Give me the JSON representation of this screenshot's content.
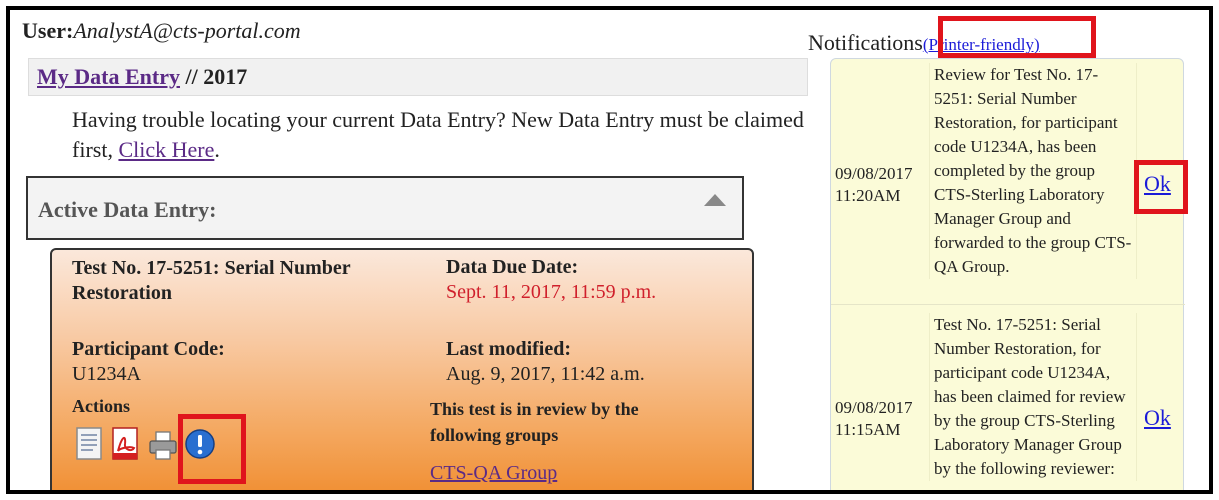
{
  "user": {
    "label": "User:",
    "email": "AnalystA@cts-portal.com"
  },
  "breadcrumb": {
    "link": "My Data Entry",
    "separator": " // ",
    "year": "2017"
  },
  "trouble": {
    "text": "Having trouble locating your current Data Entry? New Data Entry must be claimed first, ",
    "link": "Click Here",
    "suffix": "."
  },
  "active_panel": {
    "title": "Active Data Entry:"
  },
  "card": {
    "test_title": "Test No. 17-5251: Serial Number Restoration",
    "due_label": "Data Due Date:",
    "due_value": "Sept. 11, 2017, 11:59 p.m.",
    "participant_label": "Participant Code:",
    "participant_value": "U1234A",
    "modified_label": "Last modified:",
    "modified_value": "Aug. 9, 2017, 11:42 a.m.",
    "actions_label": "Actions",
    "review_text": "This test is in review by the following groups",
    "group_link": "CTS-QA Group"
  },
  "notifications": {
    "title": "Notifications",
    "printer_link": "(Printer-friendly)",
    "items": [
      {
        "date": "09/08/2017",
        "time": "11:20AM",
        "message": "Review for Test No. 17-5251: Serial Number Restoration, for participant code U1234A, has been completed by the group CTS-Sterling Laboratory Manager Group and forwarded to the group CTS-QA Group.",
        "action": "Ok"
      },
      {
        "date": "09/08/2017",
        "time": "11:15AM",
        "message": "Test No. 17-5251: Serial Number Restoration, for participant code U1234A, has been claimed for review by the group CTS-Sterling Laboratory Manager Group by the following reviewer:",
        "action": "Ok"
      }
    ]
  },
  "colors": {
    "highlight": "#e0141c",
    "link": "#1b1bd8",
    "visited_link": "#5b2a86",
    "due_date": "#d0202c"
  },
  "icons": [
    "document-icon",
    "pdf-icon",
    "printer-icon",
    "alert-icon"
  ]
}
